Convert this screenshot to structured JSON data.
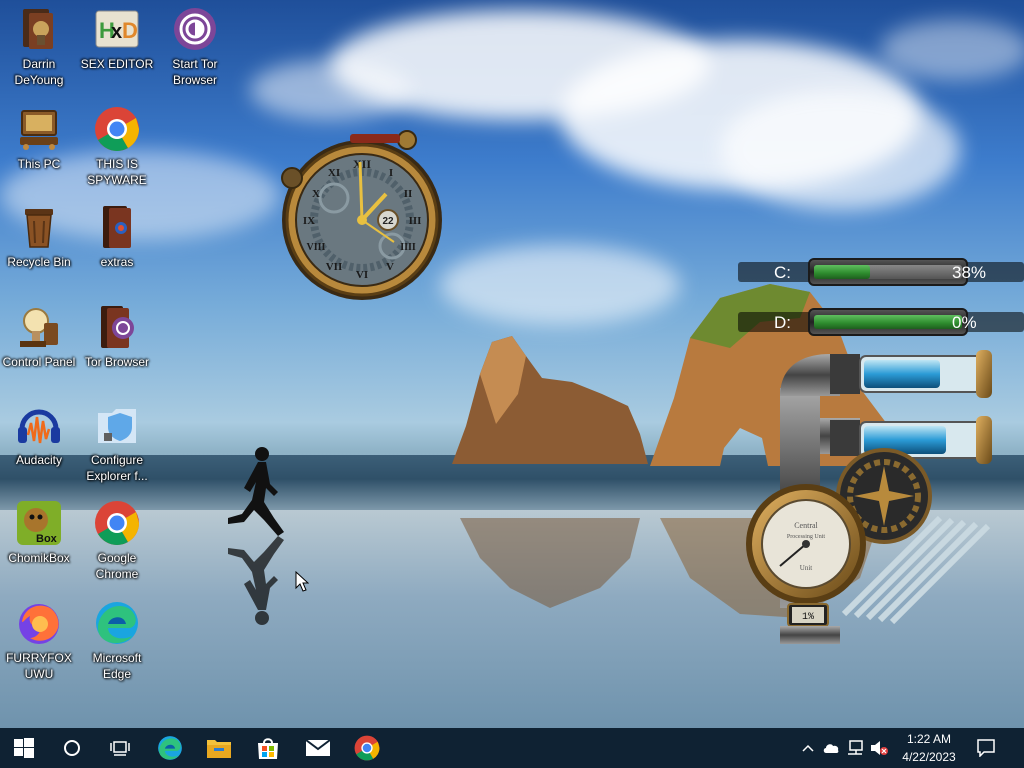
{
  "desktop": {
    "icons": [
      {
        "label": "Darrin DeYoung",
        "icon": "user-folder-icon"
      },
      {
        "label": "SEX EDITOR",
        "icon": "hxd-editor-icon"
      },
      {
        "label": "Start Tor Browser",
        "icon": "tor-browser-icon"
      },
      {
        "label": "This PC",
        "icon": "computer-icon"
      },
      {
        "label": "THIS IS SPYWARE",
        "icon": "chrome-icon"
      },
      {
        "label": "Recycle Bin",
        "icon": "recycle-bin-icon"
      },
      {
        "label": "extras",
        "icon": "folder-icon"
      },
      {
        "label": "Control Panel",
        "icon": "control-panel-icon"
      },
      {
        "label": "Tor Browser",
        "icon": "tor-folder-icon"
      },
      {
        "label": "Audacity",
        "icon": "audacity-icon"
      },
      {
        "label": "Configure Explorer f...",
        "icon": "shield-folder-icon"
      },
      {
        "label": "ChomikBox",
        "icon": "chomikbox-icon"
      },
      {
        "label": "Google Chrome",
        "icon": "chrome-icon"
      },
      {
        "label": "FURRYFOX UWU",
        "icon": "firefox-icon"
      },
      {
        "label": "Microsoft Edge",
        "icon": "edge-icon"
      }
    ]
  },
  "clock_gadget": {
    "date_day": "22",
    "numerals": [
      "XII",
      "I",
      "II",
      "III",
      "IIII",
      "V",
      "VI",
      "VII",
      "VIII",
      "IX",
      "X",
      "XI"
    ]
  },
  "drives": [
    {
      "letter": "C:",
      "percent_label": "38%",
      "used_fraction": 0.38
    },
    {
      "letter": "D:",
      "percent_label": "0%",
      "used_fraction": 0.0
    }
  ],
  "meter_gadget": {
    "dial_top": "Central",
    "dial_sub": "Processing Unit",
    "dial_bottom": "Unit",
    "readout": "1%",
    "cpu_fraction": 0.01
  },
  "taskbar": {
    "start": "windows-start-icon",
    "items": [
      "search-icon",
      "task-view-icon",
      "edge-icon",
      "file-explorer-icon",
      "store-icon",
      "mail-icon",
      "chrome-icon"
    ],
    "tray": [
      "chevron-up-icon",
      "onedrive-cloud-icon",
      "network-icon",
      "volume-muted-icon"
    ],
    "time": "1:22 AM",
    "date": "4/22/2023",
    "notifications": "notification-icon"
  },
  "colors": {
    "taskbar": "#0f2233",
    "gauge_fill": "#3a9a3a",
    "pipe_blue": "#2b9bd6",
    "brass": "#b88a3c"
  }
}
